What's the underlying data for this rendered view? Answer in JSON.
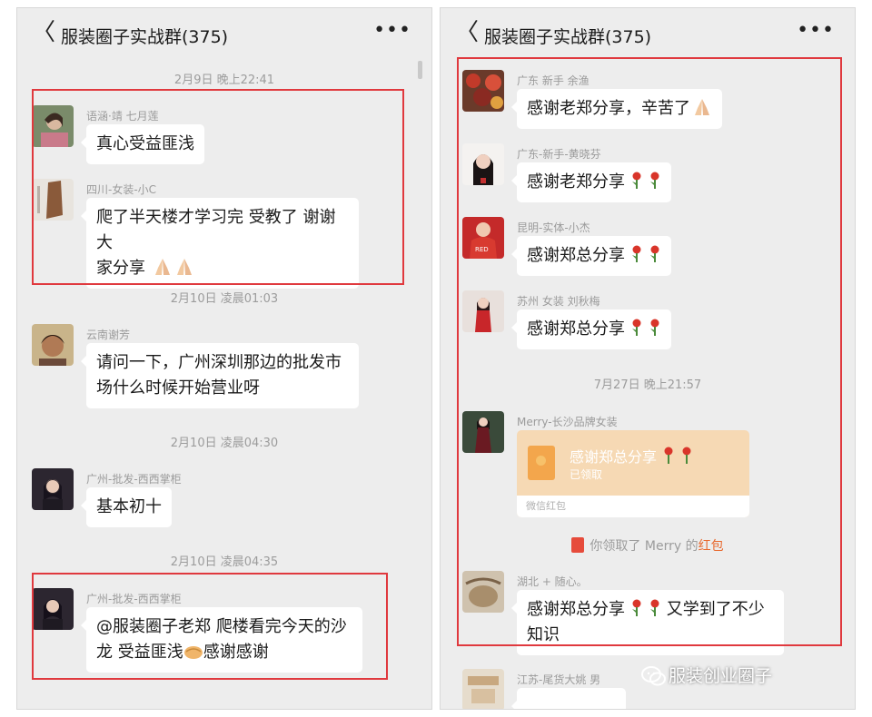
{
  "left": {
    "title": "服装圈子实战群(375)",
    "back_glyph": "〈",
    "more_glyph": "•••",
    "times": [
      "2月9日 晚上22:41",
      "2月10日 凌晨01:03",
      "2月10日 凌晨04:30",
      "2月10日 凌晨04:35"
    ],
    "messages": [
      {
        "name": "语涵·靖 七月莲",
        "text": "真心受益匪浅"
      },
      {
        "name": "四川-女装-小C",
        "line1": "爬了半天楼才学习完 受教了 谢谢大",
        "line2": "家分享"
      },
      {
        "name": "云南谢芳",
        "line1": "请问一下，广州深圳那边的批发市",
        "line2": "场什么时候开始营业呀"
      },
      {
        "name": "广州-批发-西西掌柜",
        "text": "基本初十"
      },
      {
        "name": "广州-批发-西西掌柜",
        "line1": "@服装圈子老郑  爬楼看完今天的沙",
        "line2": "龙 受益匪浅",
        "line2_after": "感谢感谢"
      }
    ]
  },
  "right": {
    "title": "服装圈子实战群(375)",
    "back_glyph": "〈",
    "more_glyph": "•••",
    "time": "7月27日 晚上21:57",
    "messages": [
      {
        "name": "广东   新手   余渔",
        "text": "感谢老郑分享，辛苦了"
      },
      {
        "name": "广东-新手-黄晓芬",
        "text": "感谢老郑分享"
      },
      {
        "name": "昆明-实体-小杰",
        "text": "感谢郑总分享"
      },
      {
        "name": "苏州 女装 刘秋梅",
        "text": "感谢郑总分享"
      },
      {
        "name": "Merry-长沙品牌女装"
      },
      {
        "name": "湖北  +  随心。",
        "line1_before": "感谢郑总分享",
        "line1_after": "又学到了不少",
        "line2": "知识"
      },
      {
        "name": "江苏-尾货大姚 男"
      }
    ],
    "hongbao": {
      "title": "感谢郑总分享",
      "status": "已领取",
      "footer": "微信红包"
    },
    "system": {
      "before": "你领取了 Merry 的",
      "link": "红包"
    }
  },
  "watermark": "服装创业圈子",
  "colors": {
    "highlight": "#e0393e",
    "chat_bg": "#ededed",
    "hongbao": "#f6d9b4",
    "link": "#e8692e"
  }
}
